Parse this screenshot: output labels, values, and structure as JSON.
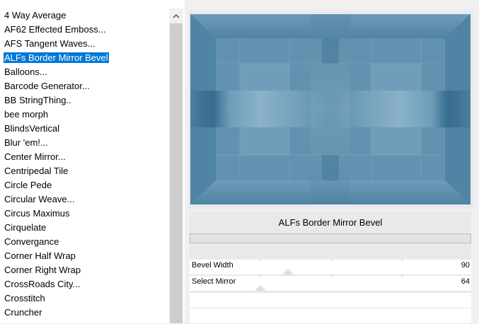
{
  "filter_list": {
    "selected_index": 3,
    "items": [
      "4 Way Average",
      "AF62 Effected Emboss...",
      "AFS Tangent Waves...",
      "ALFs Border Mirror Bevel",
      "Balloons...",
      "Barcode Generator...",
      "BB StringThing..",
      "bee morph",
      "BlindsVertical",
      "Blur 'em!...",
      "Center Mirror...",
      "Centripedal Tile",
      "Circle Pede",
      "Circular Weave...",
      "Circus Maximus",
      "Cirquelate",
      "Convergance",
      "Corner Half Wrap",
      "Corner Right Wrap",
      "CrossRoads City...",
      "Crosstitch",
      "Cruncher"
    ],
    "scroll_up_icon": "chevron-up-icon"
  },
  "preview": {
    "base_color": "#5d8fad",
    "light_color": "#8fb6cc",
    "dark_color": "#2f6689"
  },
  "settings": {
    "filter_title": "ALFs Border Mirror Bevel",
    "sliders": [
      {
        "label": "Bevel Width",
        "value": "90",
        "level": 0.35
      },
      {
        "label": "Select Mirror",
        "value": "64",
        "level": 0.25
      }
    ]
  }
}
